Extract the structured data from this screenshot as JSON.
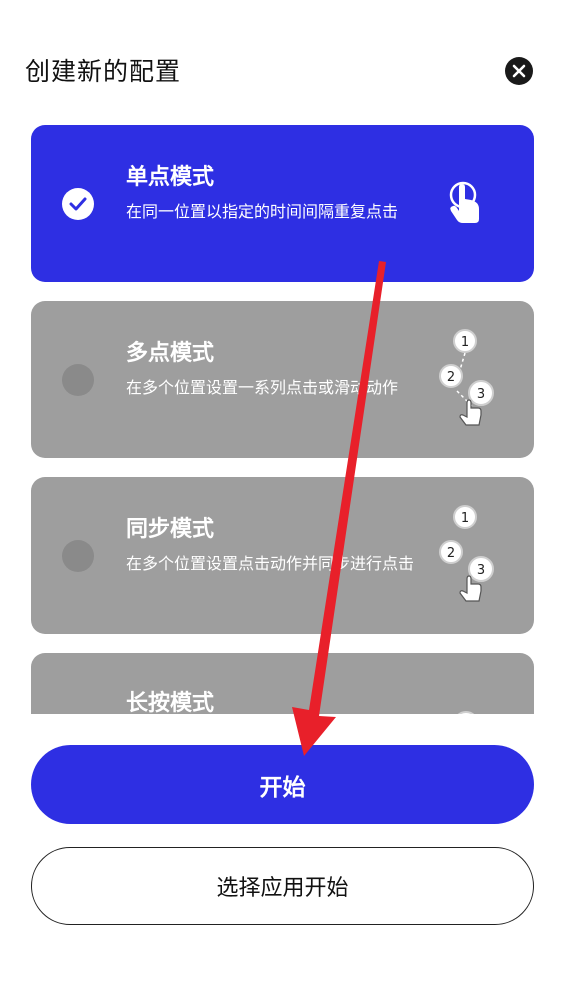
{
  "dialog": {
    "title": "创建新的配置"
  },
  "modes": [
    {
      "name": "单点模式",
      "description": "在同一位置以指定的时间间隔重复点击",
      "selected": true,
      "icon": "single-tap-icon"
    },
    {
      "name": "多点模式",
      "description": "在多个位置设置一系列点击或滑动动作",
      "selected": false,
      "icon": "multi-tap-icon",
      "steps": [
        "1",
        "2",
        "3"
      ]
    },
    {
      "name": "同步模式",
      "description": "在多个位置设置点击动作并同步进行点击",
      "selected": false,
      "icon": "sync-tap-icon",
      "steps": [
        "1",
        "2",
        "3"
      ]
    },
    {
      "name": "长按模式",
      "description": "",
      "selected": false,
      "icon": "long-press-icon"
    }
  ],
  "actions": {
    "start_label": "开始",
    "select_app_label": "选择应用开始"
  },
  "colors": {
    "accent": "#2e2fe3",
    "card_inactive": "#9e9e9e",
    "annotation_arrow": "#e8202a"
  }
}
